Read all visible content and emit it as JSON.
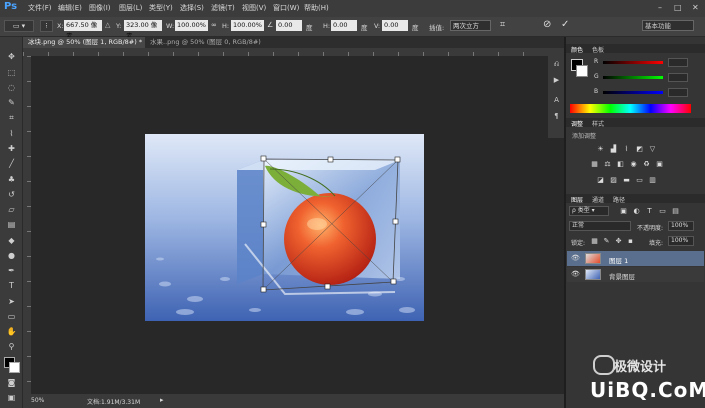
{
  "app": {
    "logo": "Ps"
  },
  "menu": [
    "文件(F)",
    "编辑(E)",
    "图像(I)",
    "图层(L)",
    "类型(Y)",
    "选择(S)",
    "滤镜(T)",
    "视图(V)",
    "窗口(W)",
    "帮助(H)"
  ],
  "window_controls": {
    "minimize": "–",
    "maximize": "□",
    "close": "✕"
  },
  "options": {
    "x_label": "X:",
    "x_value": "667.50 像素",
    "y_label": "Y:",
    "y_value": "323.00 像素",
    "w_label": "W:",
    "w_value": "100.00%",
    "h_label": "H:",
    "h_value": "100.00%",
    "angle_value": "0.00",
    "angle_unit": "度",
    "hskew_label": "H:",
    "hskew_value": "0.00",
    "vskew_label": "V:",
    "vskew_value": "0.00",
    "interp_label": "插值:",
    "interp_value": "两次立方",
    "workspace": "基本功能"
  },
  "tabs": [
    {
      "label": "冰块.png @ 50% (图层 1, RGB/8#) *",
      "close": "×",
      "active": true
    },
    {
      "label": "水果..png @ 50% (图层 0, RGB/8#)",
      "close": "×",
      "active": false
    }
  ],
  "status": {
    "zoom": "50%",
    "doc": "文档:1.91M/3.31M"
  },
  "color_panel": {
    "tab1": "颜色",
    "tab2": "色板",
    "r": "R",
    "g": "G",
    "b": "B"
  },
  "adjust_panel": {
    "tab1": "调整",
    "tab2": "样式",
    "title": "添加调整"
  },
  "layers_panel": {
    "tab1": "图层",
    "tab2": "通道",
    "tab3": "路径",
    "filter": "类型",
    "blend_mode": "正常",
    "opacity_label": "不透明度:",
    "opacity_value": "100%",
    "lock_label": "锁定:",
    "fill_label": "填充:",
    "fill_value": "100%",
    "layers": [
      {
        "name": "图层 1",
        "selected": true
      },
      {
        "name": "背景图层",
        "selected": false
      }
    ]
  },
  "watermark": {
    "brand": "极微设计",
    "site": "UiBQ.CoM"
  },
  "colors": {
    "accent": "#4aa3ff",
    "selected_layer": "#5a6f8d"
  }
}
